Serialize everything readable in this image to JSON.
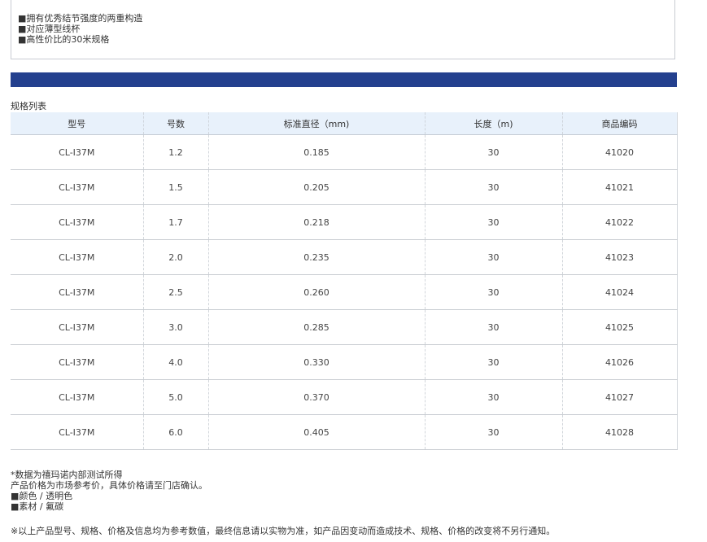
{
  "features": [
    "■拥有优秀结节强度的两重构造",
    "■对应薄型线杯",
    "■高性价比的30米规格"
  ],
  "spec_title": "规格列表",
  "table": {
    "headers": [
      "型号",
      "号数",
      "标准直径（mm)",
      "长度（m)",
      "商品编码"
    ],
    "rows": [
      [
        "CL-I37M",
        "1.2",
        "0.185",
        "30",
        "41020"
      ],
      [
        "CL-I37M",
        "1.5",
        "0.205",
        "30",
        "41021"
      ],
      [
        "CL-I37M",
        "1.7",
        "0.218",
        "30",
        "41022"
      ],
      [
        "CL-I37M",
        "2.0",
        "0.235",
        "30",
        "41023"
      ],
      [
        "CL-I37M",
        "2.5",
        "0.260",
        "30",
        "41024"
      ],
      [
        "CL-I37M",
        "3.0",
        "0.285",
        "30",
        "41025"
      ],
      [
        "CL-I37M",
        "4.0",
        "0.330",
        "30",
        "41026"
      ],
      [
        "CL-I37M",
        "5.0",
        "0.370",
        "30",
        "41027"
      ],
      [
        "CL-I37M",
        "6.0",
        "0.405",
        "30",
        "41028"
      ]
    ]
  },
  "notes": [
    "*数据为禧玛诺内部测试所得",
    "产品价格为市场参考价，具体价格请至门店确认。",
    "■颜色 / 透明色",
    "■素材 / 氟碳"
  ],
  "disclaimer": "※以上产品型号、规格、价格及信息均为参考数值，最终信息请以实物为准，如产品因变动而造成技术、规格、价格的改变将不另行通知。",
  "colors": {
    "bar": "#24408e",
    "header_bg": "#e8f1fb"
  }
}
